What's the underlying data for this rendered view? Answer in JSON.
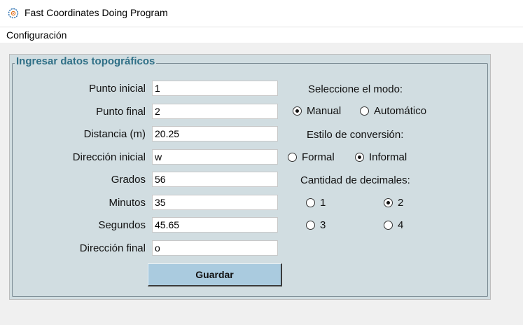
{
  "window": {
    "title": "Fast Coordinates Doing Program",
    "icon": "crosshair-gear-icon"
  },
  "menu": {
    "items": [
      {
        "label": "Configuración"
      }
    ]
  },
  "group": {
    "title": "Ingresar datos topográficos"
  },
  "fields": {
    "punto_inicial": {
      "label": "Punto inicial",
      "value": "1"
    },
    "punto_final": {
      "label": "Punto final",
      "value": "2"
    },
    "distancia": {
      "label": "Distancia (m)",
      "value": "20.25"
    },
    "direccion_inicial": {
      "label": "Dirección inicial",
      "value": "w"
    },
    "grados": {
      "label": "Grados",
      "value": "56"
    },
    "minutos": {
      "label": "Minutos",
      "value": "35"
    },
    "segundos": {
      "label": "Segundos",
      "value": "45.65"
    },
    "direccion_final": {
      "label": "Dirección final",
      "value": "o"
    }
  },
  "mode": {
    "heading": "Seleccione el modo:",
    "options": [
      {
        "label": "Manual",
        "selected": true
      },
      {
        "label": "Automático",
        "selected": false
      }
    ]
  },
  "style": {
    "heading": "Estilo de conversión:",
    "options": [
      {
        "label": "Formal",
        "selected": false
      },
      {
        "label": "Informal",
        "selected": true
      }
    ]
  },
  "decimals": {
    "heading": "Cantidad de decimales:",
    "options": [
      {
        "label": "1",
        "selected": false
      },
      {
        "label": "2",
        "selected": true
      },
      {
        "label": "3",
        "selected": false
      },
      {
        "label": "4",
        "selected": false
      }
    ]
  },
  "save_button": {
    "label": "Guardar"
  },
  "colors": {
    "panel": "#d1dde1",
    "group_title": "#2f6f86",
    "button": "#aacbdf"
  }
}
